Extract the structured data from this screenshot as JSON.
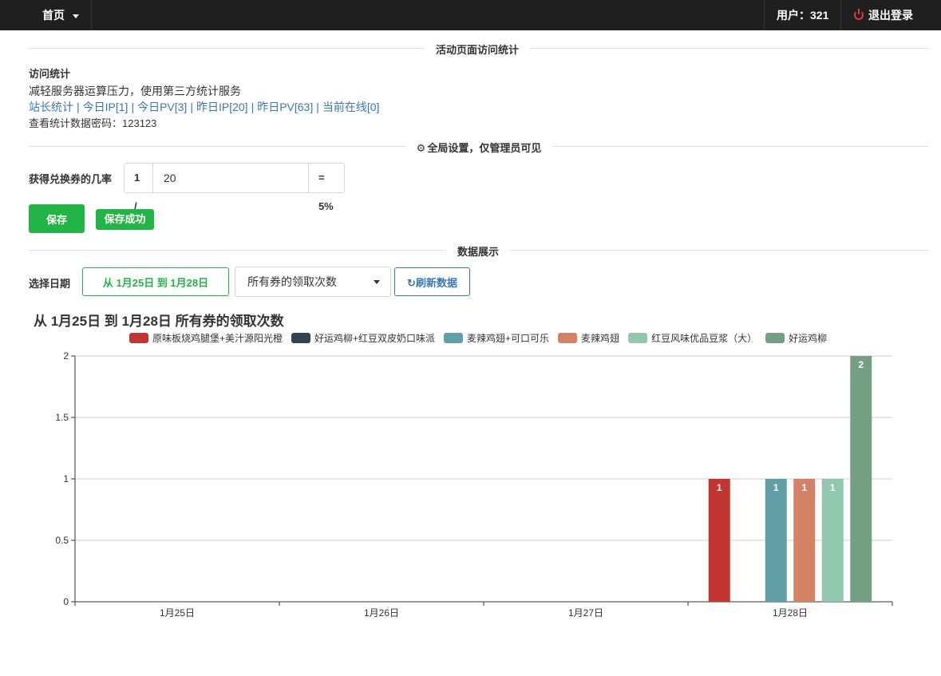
{
  "navbar": {
    "home_label": "首页",
    "user_label": "用户：321",
    "logout_label": "退出登录"
  },
  "sections": {
    "stats_header": "活动页面访问统计",
    "settings_header": "全局设置，仅管理员可见",
    "data_header": "数据展示"
  },
  "stats": {
    "title": "访问统计",
    "description": "减轻服务器运算压力，使用第三方统计服务",
    "links": [
      "站长统计",
      "今日IP[1]",
      "今日PV[3]",
      "昨日IP[20]",
      "昨日PV[63]",
      "当前在线[0]"
    ],
    "separator": "|",
    "password_line": "查看统计数据密码：123123"
  },
  "settings": {
    "rate_label": "获得兑换券的几率",
    "prefix": "1 /",
    "value": "20",
    "result": "= 5%",
    "save_label": "保存",
    "saved_badge": "保存成功"
  },
  "filters": {
    "date_label": "选择日期",
    "date_range": "从 1月25日 到 1月28日",
    "metric_selected": "所有券的领取次数",
    "refresh_label": "刷新数据"
  },
  "colors": {
    "accent_green": "#22b546",
    "link_blue": "#3a78b5",
    "navbar_bg": "#1f1f1f",
    "danger_red": "#e03a3a"
  },
  "chart_data": {
    "type": "bar",
    "title": "从 1月25日 到 1月28日 所有券的领取次数",
    "xlabel": "",
    "ylabel": "",
    "categories": [
      "1月25日",
      "1月26日",
      "1月27日",
      "1月28日"
    ],
    "ylim": [
      0,
      2
    ],
    "yticks": [
      0,
      0.5,
      1,
      1.5,
      2
    ],
    "grid": true,
    "legend_position": "top",
    "series": [
      {
        "name": "原味板烧鸡腿堡+美汁源阳光橙",
        "color": "#c23531",
        "values": [
          0,
          0,
          0,
          1
        ]
      },
      {
        "name": "好运鸡柳+红豆双皮奶口味派",
        "color": "#2f4554",
        "values": [
          0,
          0,
          0,
          0
        ]
      },
      {
        "name": "麦辣鸡翅+可口可乐",
        "color": "#61a0a8",
        "values": [
          0,
          0,
          0,
          1
        ]
      },
      {
        "name": "麦辣鸡翅",
        "color": "#d48265",
        "values": [
          0,
          0,
          0,
          1
        ]
      },
      {
        "name": "红豆风味优品豆浆（大）",
        "color": "#91c7ae",
        "values": [
          0,
          0,
          0,
          1
        ]
      },
      {
        "name": "好运鸡柳",
        "color": "#749f83",
        "values": [
          0,
          0,
          0,
          2
        ]
      }
    ]
  }
}
